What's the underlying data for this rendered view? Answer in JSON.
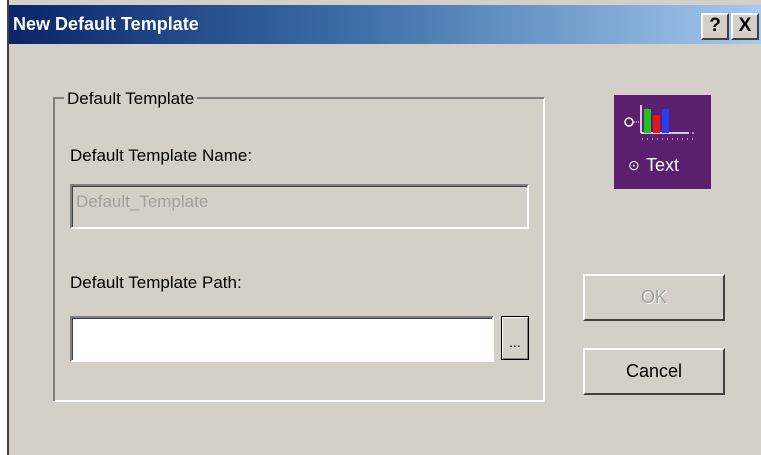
{
  "window": {
    "title": "New Default Template",
    "help_label": "?",
    "close_label": "X"
  },
  "group": {
    "legend": "Default Template",
    "name_label": "Default Template Name:",
    "name_value": "Default_Template",
    "path_label": "Default Template Path:",
    "path_value": "",
    "browse_label": "..."
  },
  "buttons": {
    "ok": "OK",
    "cancel": "Cancel"
  },
  "icon": {
    "semantic": "template-chart-icon",
    "caption": "Text",
    "radio_symbol": "⊙",
    "colors": {
      "background": "#5a1f6e",
      "green": "#1fc21f",
      "red": "#e01818",
      "blue": "#2a3cf0"
    }
  },
  "colors": {
    "title_gradient_start": "#0a246a",
    "title_gradient_end": "#a6caf0",
    "dialog_bg": "#d4d0c8"
  }
}
